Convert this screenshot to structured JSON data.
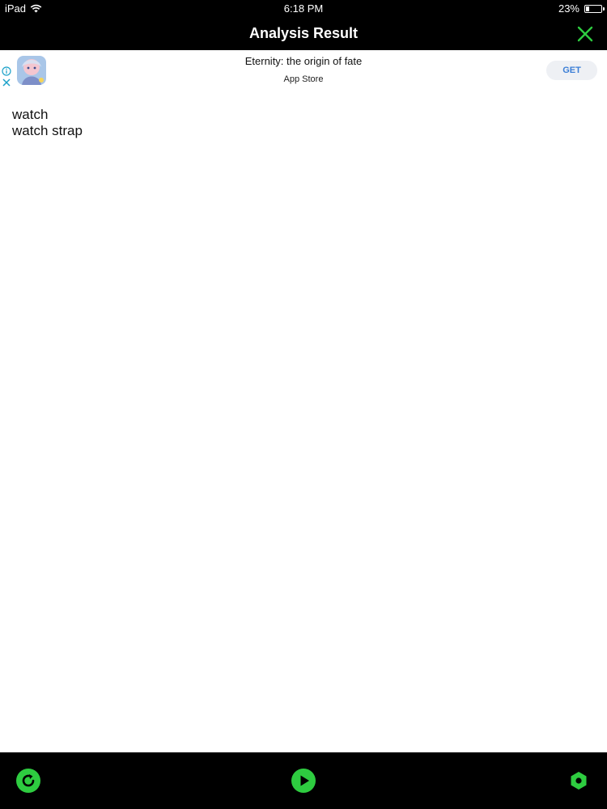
{
  "status_bar": {
    "device": "iPad",
    "time": "6:18 PM",
    "battery_percent": "23%",
    "battery_level": 0.23,
    "wifi_icon": "wifi-icon"
  },
  "header": {
    "title": "Analysis Result",
    "close_icon": "close-icon",
    "accent_color": "#2ecc40"
  },
  "ad": {
    "title": "Eternity: the origin of fate",
    "subtitle": "App Store",
    "get_label": "GET",
    "info_icon": "info-icon",
    "close_icon": "close-icon"
  },
  "results": {
    "items": [
      "watch",
      "watch strap"
    ]
  },
  "toolbar": {
    "refresh_icon": "refresh-icon",
    "play_icon": "play-icon",
    "settings_icon": "hexagon-settings-icon",
    "icon_color": "#2ecc40"
  }
}
